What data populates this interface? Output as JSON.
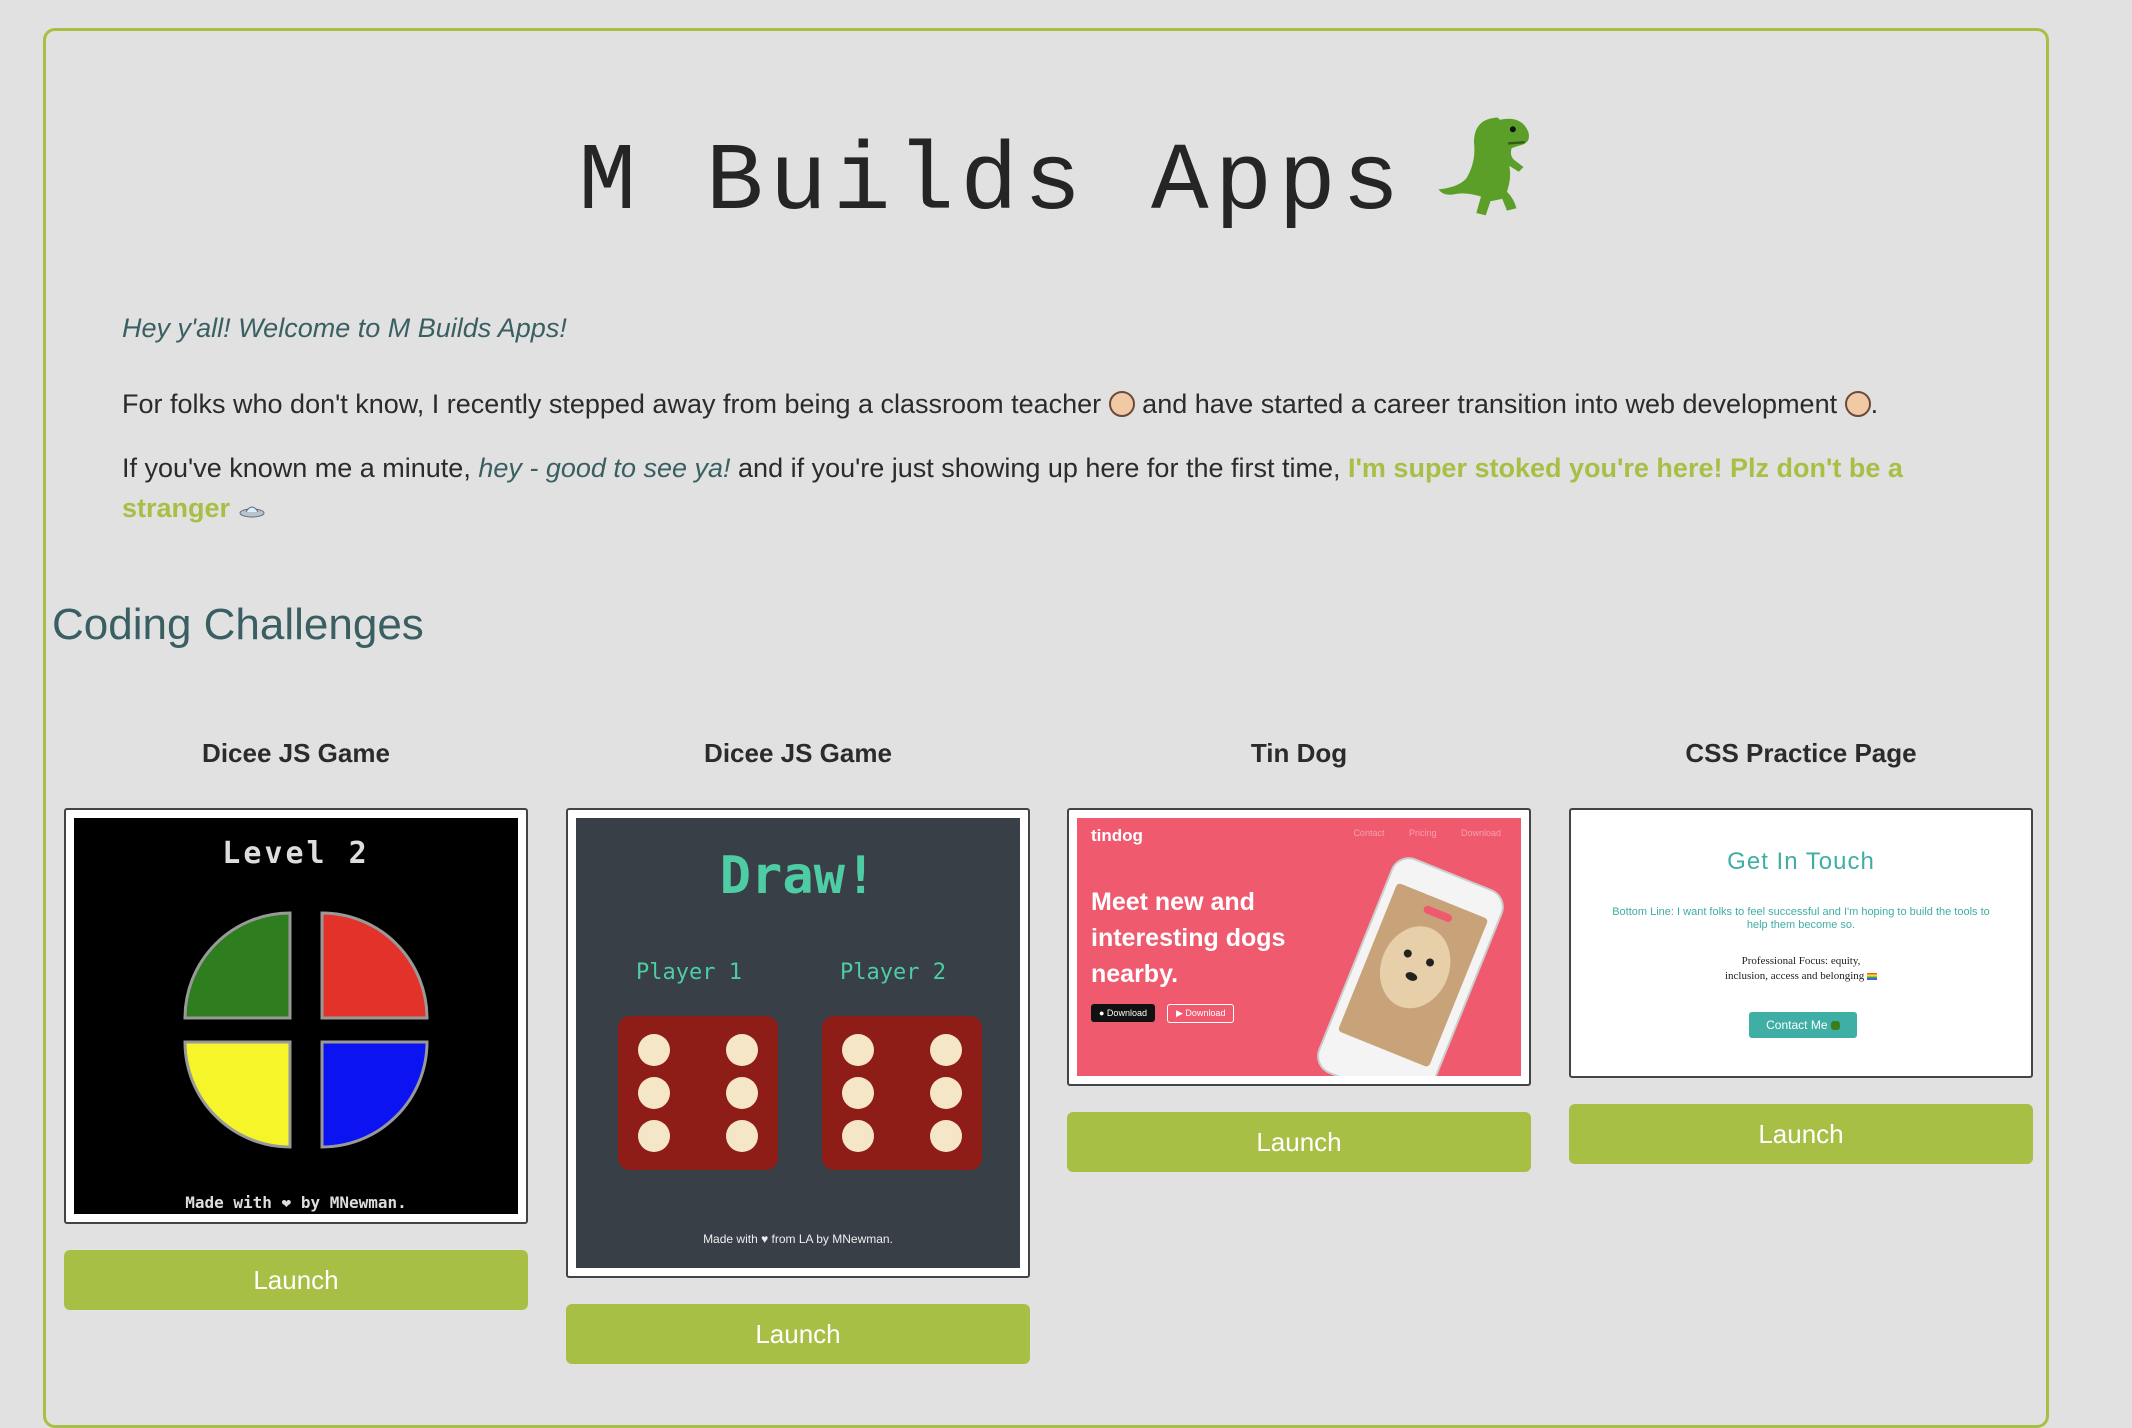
{
  "header": {
    "title": "M Builds Apps",
    "title_icon": "t-rex-icon"
  },
  "intro": {
    "welcome": "Hey y'all! Welcome to M Builds Apps!",
    "p1_a": "For folks who don't know, I recently stepped away from being a classroom teacher",
    "p1_b": "and have started a career transition into web development",
    "p1_end": ".",
    "p2_a": "If you've known me a minute,",
    "p2_em": "hey - good to see ya!",
    "p2_b": "and if you're just showing up here for the first time,",
    "p2_strong": "I'm super stoked you're here! Plz don't be a stranger"
  },
  "section": {
    "title": "Coding Challenges"
  },
  "cards": [
    {
      "title": "Dicee JS Game",
      "launch": "Launch",
      "thumb": {
        "heading": "Level 2",
        "footer": "Made with ❤ by MNewman."
      }
    },
    {
      "title": "Dicee JS Game",
      "launch": "Launch",
      "thumb": {
        "heading": "Draw!",
        "player1": "Player 1",
        "player2": "Player 2",
        "footer": "Made with ♥ from LA by MNewman."
      }
    },
    {
      "title": "Tin Dog",
      "launch": "Launch",
      "thumb": {
        "logo": "tindog",
        "nav": "Contact Pricing Download",
        "heading": "Meet new and interesting dogs nearby.",
        "btn1": "● Download",
        "btn2": "▶ Download"
      }
    },
    {
      "title": "CSS Practice Page",
      "launch": "Launch",
      "thumb": {
        "heading": "Get In Touch",
        "line": "Bottom Line: I want folks to feel successful and I'm hoping to build the tools to help them become so.",
        "focus1": "Professional Focus: equity,",
        "focus2": "inclusion, access and belonging",
        "button": "Contact Me"
      }
    }
  ],
  "colors": {
    "accent": "#a8bf45",
    "teal": "#3a5f62",
    "background": "#e1e1e1"
  }
}
